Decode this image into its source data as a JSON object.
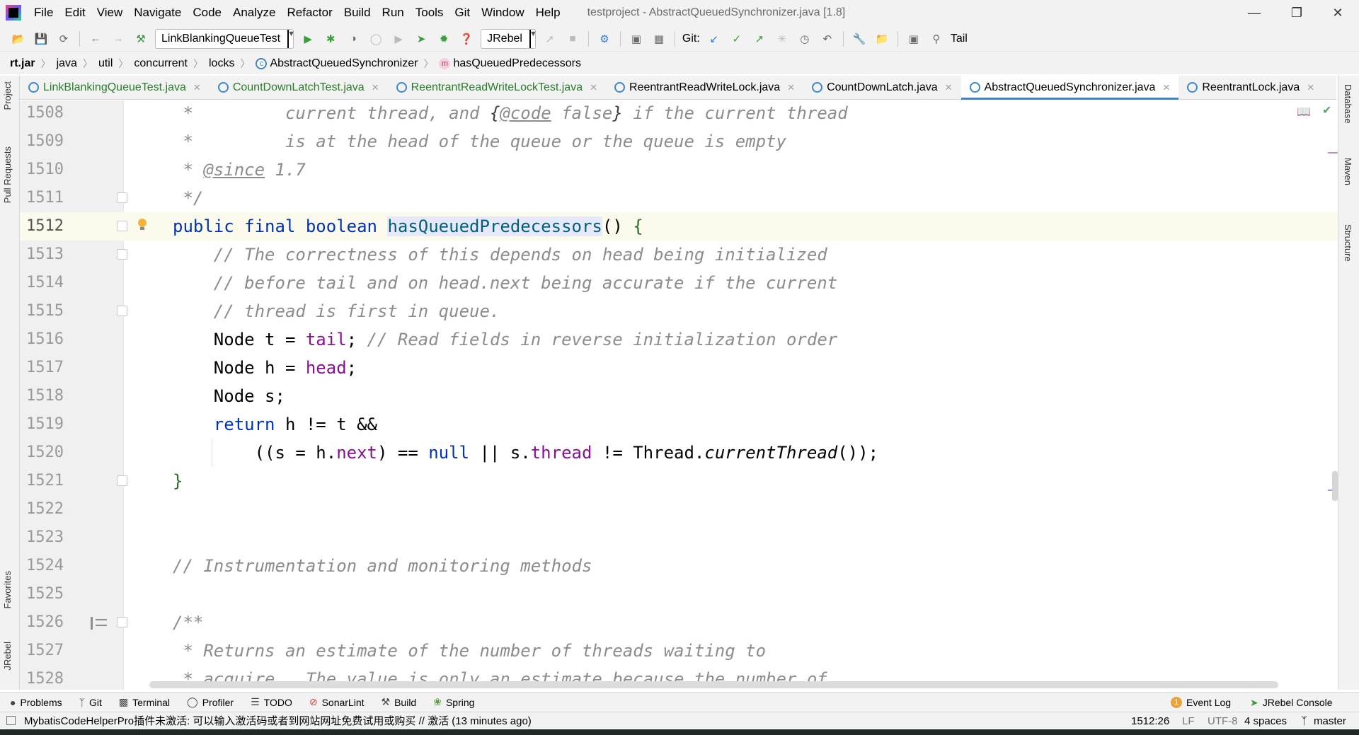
{
  "window": {
    "title": "testproject - AbstractQueuedSynchronizer.java [1.8]",
    "menu": [
      "File",
      "Edit",
      "View",
      "Navigate",
      "Code",
      "Analyze",
      "Refactor",
      "Build",
      "Run",
      "Tools",
      "Git",
      "Window",
      "Help"
    ]
  },
  "toolbar": {
    "run_config": "LinkBlankingQueueTest",
    "jrebel": "JRebel",
    "git_label": "Git:",
    "tail_label": "Tail"
  },
  "breadcrumb": [
    "rt.jar",
    "java",
    "util",
    "concurrent",
    "locks",
    "AbstractQueuedSynchronizer",
    "hasQueuedPredecessors"
  ],
  "tabs": [
    {
      "label": "LinkBlankingQueueTest.java",
      "active": false
    },
    {
      "label": "CountDownLatchTest.java",
      "active": false
    },
    {
      "label": "ReentrantReadWriteLockTest.java",
      "active": false
    },
    {
      "label": "ReentrantReadWriteLock.java",
      "active": false
    },
    {
      "label": "CountDownLatch.java",
      "active": false
    },
    {
      "label": "AbstractQueuedSynchronizer.java",
      "active": true
    },
    {
      "label": "ReentrantLock.java",
      "active": false
    }
  ],
  "left_tools": [
    "Project",
    "Pull Requests",
    "Favorites",
    "JRebel"
  ],
  "right_tools": [
    "Database",
    "Maven",
    "Structure"
  ],
  "editor": {
    "lines": [
      {
        "n": "1508"
      },
      {
        "n": "1509"
      },
      {
        "n": "1510"
      },
      {
        "n": "1511"
      },
      {
        "n": "1512"
      },
      {
        "n": "1513"
      },
      {
        "n": "1514"
      },
      {
        "n": "1515"
      },
      {
        "n": "1516"
      },
      {
        "n": "1517"
      },
      {
        "n": "1518"
      },
      {
        "n": "1519"
      },
      {
        "n": "1520"
      },
      {
        "n": "1521"
      },
      {
        "n": "1522"
      },
      {
        "n": "1523"
      },
      {
        "n": "1524"
      },
      {
        "n": "1525"
      },
      {
        "n": "1526"
      },
      {
        "n": "1527"
      },
      {
        "n": "1528"
      }
    ],
    "tokens": {
      "l1508_a": " *         current thread, and ",
      "l1508_b": "{",
      "l1508_c": "@code",
      "l1508_d": " false",
      "l1508_e": "}",
      "l1508_f": " if the current thread",
      "l1509": " *         is at the head of the queue or the queue is empty",
      "l1510_a": " * ",
      "l1510_b": "@since",
      "l1510_c": " 1.7",
      "l1511": " */",
      "l1512_kw": "public final boolean ",
      "l1512_method": "hasQueuedPredecessors",
      "l1512_paren": "() ",
      "l1512_brace": "{",
      "l1513": "    // The correctness of this depends on head being initialized",
      "l1514": "    // before tail and on head.next being accurate if the current",
      "l1515": "    // thread is first in queue.",
      "l1516_a": "    Node t = ",
      "l1516_b": "tail",
      "l1516_c": "; ",
      "l1516_d": "// Read fields in reverse initialization order",
      "l1517_a": "    Node h = ",
      "l1517_b": "head",
      "l1517_c": ";",
      "l1518": "    Node s;",
      "l1519_kw": "    return",
      "l1519_rest": " h != t &&",
      "l1520_a": "        ((s = h.",
      "l1520_b": "next",
      "l1520_c": ") == ",
      "l1520_d": "null",
      "l1520_e": " || s.",
      "l1520_f": "thread",
      "l1520_g": " != Thread.",
      "l1520_h": "currentThread",
      "l1520_i": "());",
      "l1521": "}",
      "l1524": "// Instrumentation and monitoring methods",
      "l1526": "/**",
      "l1527": " * Returns an estimate of the number of threads waiting to",
      "l1528": " * acquire.  The value is only an estimate because the number of"
    }
  },
  "toolwindows": {
    "items": [
      "Problems",
      "Git",
      "Terminal",
      "Profiler",
      "TODO",
      "SonarLint",
      "Build",
      "Spring"
    ],
    "event_log": "Event Log",
    "event_count": "1",
    "jrebel_console": "JRebel Console"
  },
  "status": {
    "message": "MybatisCodeHelperPro插件未激活: 可以输入激活码或者到网站网址免费试用或购买 // 激活 (13 minutes ago)",
    "position": "1512:26",
    "line_sep": "LF",
    "encoding": "UTF-8",
    "indent": "4 spaces",
    "branch": "master"
  }
}
